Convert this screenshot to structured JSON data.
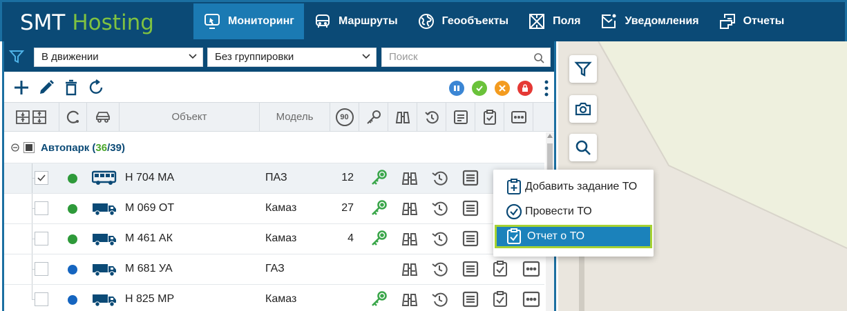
{
  "brand": {
    "part1": "SMT",
    "part2": "Hosting"
  },
  "nav": [
    {
      "label": "Мониторинг",
      "icon": "monitoring-icon",
      "active": true
    },
    {
      "label": "Маршруты",
      "icon": "bus-route-icon"
    },
    {
      "label": "Геообъекты",
      "icon": "globe-icon"
    },
    {
      "label": "Поля",
      "icon": "field-icon"
    },
    {
      "label": "Уведомления",
      "icon": "notification-icon"
    },
    {
      "label": "Отчеты",
      "icon": "reports-icon"
    }
  ],
  "filters": {
    "status_value": "В движении",
    "grouping_value": "Без группировки",
    "search_placeholder": "Поиск"
  },
  "table": {
    "col_object": "Объект",
    "col_model": "Модель",
    "col_speed_badge": "90"
  },
  "group": {
    "name": "Автопарк",
    "open": "(",
    "online": "36",
    "sep": "/",
    "total": "39",
    "close": ")"
  },
  "rows": [
    {
      "plate": "Н 704 МА",
      "model": "ПАЗ",
      "speed": "12",
      "status": "green",
      "vehicle": "bus",
      "checked": true,
      "key": true,
      "checklist": true
    },
    {
      "plate": "М 069 ОТ",
      "model": "Камаз",
      "speed": "27",
      "status": "green",
      "vehicle": "truck",
      "checked": false,
      "key": true,
      "checklist": true
    },
    {
      "plate": "М 461 АК",
      "model": "Камаз",
      "speed": "4",
      "status": "green",
      "vehicle": "truck",
      "checked": false,
      "key": true,
      "checklist": true
    },
    {
      "plate": "М 681 УА",
      "model": "ГАЗ",
      "speed": "",
      "status": "blue",
      "vehicle": "truck",
      "checked": false,
      "key": false,
      "checklist": true
    },
    {
      "plate": "Н 825 МР",
      "model": "Камаз",
      "speed": "",
      "status": "blue",
      "vehicle": "truck",
      "checked": false,
      "key": true,
      "checklist": true
    }
  ],
  "context_menu": {
    "items": [
      {
        "label": "Добавить задание ТО",
        "icon": "add-task-icon"
      },
      {
        "label": "Провести ТО",
        "icon": "check-circle-icon"
      },
      {
        "label": "Отчет о ТО",
        "icon": "report-clipboard-icon",
        "active": true
      }
    ]
  },
  "colors": {
    "header_bg": "#0b4a76",
    "accent": "#1b7ab3",
    "brand_green": "#7fc241",
    "online_green": "#2e9a3a",
    "offline_blue": "#1565c0",
    "key_green": "#3aa64a",
    "menu_highlight_border": "#a6d232"
  }
}
